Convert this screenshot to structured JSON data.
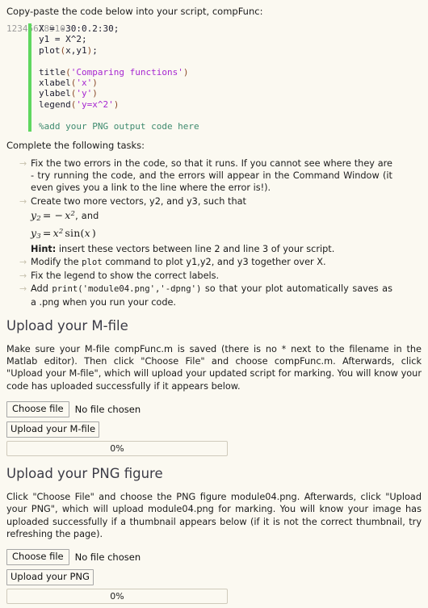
{
  "intro": "Copy-paste the code below into your script, compFunc:",
  "code": {
    "line_numbers": [
      "1",
      "2",
      "3",
      "4",
      "5",
      "6",
      "7",
      "8",
      "9",
      "10"
    ],
    "lines": [
      [
        {
          "t": "X = -30:0.2:30;",
          "c": "plain"
        }
      ],
      [
        {
          "t": "y1 = X^2;",
          "c": "plain"
        }
      ],
      [
        {
          "t": "plot",
          "c": "plain"
        },
        {
          "t": "(",
          "c": "pun"
        },
        {
          "t": "x,y1",
          "c": "plain"
        },
        {
          "t": ")",
          "c": "pun"
        },
        {
          "t": ";",
          "c": "plain"
        }
      ],
      [],
      [
        {
          "t": "title",
          "c": "plain"
        },
        {
          "t": "(",
          "c": "pun"
        },
        {
          "t": "'Comparing functions'",
          "c": "str"
        },
        {
          "t": ")",
          "c": "pun"
        }
      ],
      [
        {
          "t": "xlabel",
          "c": "plain"
        },
        {
          "t": "(",
          "c": "pun"
        },
        {
          "t": "'x'",
          "c": "str"
        },
        {
          "t": ")",
          "c": "pun"
        }
      ],
      [
        {
          "t": "ylabel",
          "c": "plain"
        },
        {
          "t": "(",
          "c": "pun"
        },
        {
          "t": "'y'",
          "c": "str"
        },
        {
          "t": ")",
          "c": "pun"
        }
      ],
      [
        {
          "t": "legend",
          "c": "plain"
        },
        {
          "t": "(",
          "c": "pun"
        },
        {
          "t": "'y=x^2'",
          "c": "str"
        },
        {
          "t": ")",
          "c": "pun"
        }
      ],
      [],
      [
        {
          "t": "%add your PNG output code here",
          "c": "com"
        }
      ]
    ]
  },
  "tasks_heading": "Complete the following tasks:",
  "tasks": {
    "bullet": "→",
    "t1": "Fix the two errors in the code, so that it runs. If you cannot see where they are - try running the code, and the errors will appear in the Command Window (it even gives you a link to the line where the error is!).",
    "t2_lead": "Create two more vectors, y2, and y3, such that",
    "t2_math1_var": "y",
    "t2_math1_sub": "2",
    "t2_math1_eq": "=",
    "t2_math1_rhs_sign": "−",
    "t2_math1_rhs_var": "x",
    "t2_math1_rhs_sup": "2",
    "t2_math1_tail": ", and",
    "t2_math2_var": "y",
    "t2_math2_sub": "3",
    "t2_math2_eq": "=",
    "t2_math2_rhs_var": "x",
    "t2_math2_rhs_sup": "2",
    "t2_math2_fn": "sin(",
    "t2_math2_arg": "x",
    "t2_math2_close": ")",
    "t2_hint_label": "Hint:",
    "t2_hint_text": " insert these vectors between line 2 and line 3 of your script.",
    "t3_a": "Modify the ",
    "t3_code": "plot",
    "t3_b": " command to plot y1,y2, and y3 together over X.",
    "t4": "Fix the legend to show the correct labels.",
    "t5_a": "Add ",
    "t5_code": "print('module04.png','-dpng')",
    "t5_b": " so that your plot automatically saves as a .png when you run your code."
  },
  "mfile": {
    "heading": "Upload your M-file",
    "body": "Make sure your M-file compFunc.m is saved (there is no * next to the filename in the Matlab editor). Then click \"Choose File\" and choose compFunc.m. Afterwards, click \"Upload your M-file\", which will upload your updated script for marking. You will know your code has uploaded successfully if it appears below.",
    "choose_label": "Choose file",
    "no_file": "No file chosen",
    "upload_label": "Upload your M-file",
    "progress": "0%",
    "progress_value": 0
  },
  "png": {
    "heading": "Upload your PNG figure",
    "body": "Click \"Choose File\" and choose the PNG figure module04.png. Afterwards, click \"Upload your PNG\", which will upload module04.png for marking. You will know your image has uploaded successfully if a thumbnail appears below (if it is not the correct thumbnail, try refreshing the page).",
    "choose_label": "Choose file",
    "no_file": "No file chosen",
    "upload_label": "Upload your PNG",
    "progress": "0%",
    "progress_value": 0
  },
  "colors": {
    "page_bg": "#fbf9f1",
    "code_bar": "#5fd75f",
    "string": "#a626d1",
    "comment": "#3d8a6e",
    "punct": "#8a4b2a",
    "heading": "#3b3b46",
    "bullet": "#c9c3b0"
  }
}
